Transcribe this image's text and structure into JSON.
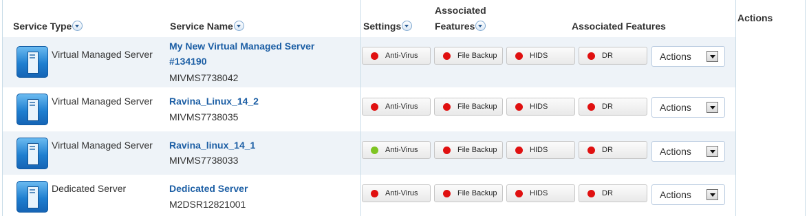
{
  "columns": {
    "service_type": "Service Type",
    "service_name": "Service Name",
    "settings": "Settings",
    "assoc_features_top": "Associated",
    "assoc_features_bottom": "Features",
    "assoc_features_2": "Associated Features",
    "actions": "Actions"
  },
  "colors": {
    "status_red": "#e01010",
    "status_green": "#7ec421",
    "link_blue": "#1d5fa5"
  },
  "rows": [
    {
      "type": "Virtual Managed Server",
      "name_line1": "My New Virtual Managed Server",
      "name_line2": "#134190",
      "id": "MIVMS7738042",
      "features": [
        {
          "label": "Anti-Virus",
          "status": "red"
        },
        {
          "label": "File Backup",
          "status": "red"
        },
        {
          "label": "HIDS",
          "status": "red"
        },
        {
          "label": "DR",
          "status": "red"
        }
      ],
      "action": "Actions"
    },
    {
      "type": "Virtual Managed Server",
      "name_line1": "Ravina_Linux_14_2",
      "name_line2": "",
      "id": "MIVMS7738035",
      "features": [
        {
          "label": "Anti-Virus",
          "status": "red"
        },
        {
          "label": "File Backup",
          "status": "red"
        },
        {
          "label": "HIDS",
          "status": "red"
        },
        {
          "label": "DR",
          "status": "red"
        }
      ],
      "action": "Actions"
    },
    {
      "type": "Virtual Managed Server",
      "name_line1": "Ravina_linux_14_1",
      "name_line2": "",
      "id": "MIVMS7738033",
      "features": [
        {
          "label": "Anti-Virus",
          "status": "green"
        },
        {
          "label": "File Backup",
          "status": "red"
        },
        {
          "label": "HIDS",
          "status": "red"
        },
        {
          "label": "DR",
          "status": "red"
        }
      ],
      "action": "Actions"
    },
    {
      "type": "Dedicated Server",
      "name_line1": "Dedicated Server",
      "name_line2": "",
      "id": "M2DSR12821001",
      "features": [
        {
          "label": "Anti-Virus",
          "status": "red"
        },
        {
          "label": "File Backup",
          "status": "red"
        },
        {
          "label": "HIDS",
          "status": "red"
        },
        {
          "label": "DR",
          "status": "red"
        }
      ],
      "action": "Actions"
    }
  ]
}
